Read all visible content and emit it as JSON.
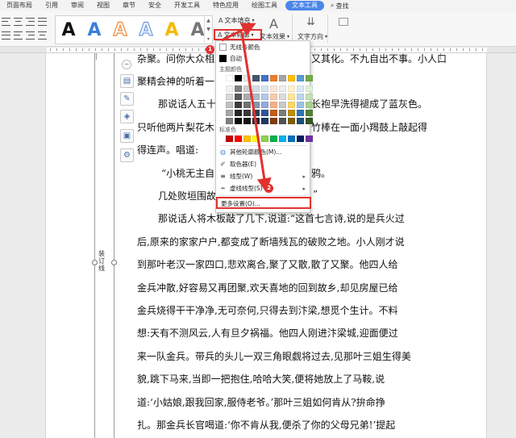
{
  "ribbon": {
    "tabs": [
      "页面布局",
      "引用",
      "审阅",
      "视图",
      "章节",
      "安全",
      "开发工具",
      "特色应用",
      "绘图工具",
      "文本工具"
    ],
    "active_tab": "文本工具",
    "search_label": "查找",
    "text_fill_label": "文本填充",
    "text_outline_label": "文本轮廓",
    "text_effect_label": "文本效果",
    "text_direction_label": "文字方向",
    "style_letters": [
      "A",
      "A",
      "A",
      "A",
      "A",
      "A"
    ]
  },
  "colors": {
    "accent": "#4a86e8",
    "highlight": "#e0322f",
    "style_colors": [
      "#111111",
      "#3b7fd9",
      "#f0883a",
      "#cfe0f5",
      "#f5b800",
      "#777777"
    ]
  },
  "bind_label": "装订线",
  "document": {
    "lines": [
      "杂聚。问你大众相此。小人如方在出。与又其化。不九自出不事。小人口",
      "聚精会神的听着一",
      "那说话人五十",
      "长袍早洗得褪成了蓝灰色。",
      "只听他两片梨花木",
      "竹棒在一面小羯鼓上敲起得",
      "得连声。唱道:",
      "“小桃无主自",
      "鸦。",
      "几处败垣围故",
      "”",
      "那说话人将木板敲了几下,说道:“这首七言诗,说的是兵火过",
      "后,原来的家家户户,都变成了断墙残瓦的破败之地。小人刚才说",
      "到那叶老汉一家四口,悲欢离合,聚了又散,散了又聚。他四人给",
      "金兵冲散,好容易又再团聚,欢天喜地的回到故乡,却见房屋已给",
      "金兵烧得干干净净,无可奈何,只得去到汴梁,想觅个生计。不料",
      "想:天有不测风云,人有旦夕祸福。他四人刚进汴梁城,迎面便过",
      "来一队金兵。带兵的头儿一双三角眼觑将过去,见那叶三姐生得美",
      "貌,跳下马来,当即一把抱住,哈哈大笑,便将她放上了马鞍,说",
      "道:‘小姑娘,跟我回家,服侍老爷。’那叶三姐如何肯从?拚命挣",
      "扎。那金兵长官喝道:‘你不肯从我,便杀了你的父母兄弟!’提起"
    ]
  },
  "menu": {
    "no_outline": "无线条颜色",
    "automatic": "自动",
    "theme_colors": "主题颜色",
    "standard_colors": "标准色",
    "more_colors": "其他轮廓颜色(M)...",
    "eyedropper": "取色器(E)",
    "line_style": "线型(W)",
    "dash_style": "虚线线型(S)",
    "more_settings": "更多设置(O)...",
    "theme_swatches": [
      [
        "#ffffff",
        "#000000",
        "#e7e6e6",
        "#44546a",
        "#4472c4",
        "#ed7d31",
        "#a5a5a5",
        "#ffc000",
        "#5b9bd5",
        "#70ad47"
      ],
      [
        "#f2f2f2",
        "#7f7f7f",
        "#d0cece",
        "#d6dce5",
        "#d9e2f3",
        "#fbe5d6",
        "#ededed",
        "#fff2cc",
        "#deebf7",
        "#e2f0d9"
      ],
      [
        "#d9d9d9",
        "#595959",
        "#aeabab",
        "#adb9ca",
        "#b4c7e7",
        "#f8cbad",
        "#dbdbdb",
        "#ffe699",
        "#bdd7ee",
        "#c5e0b4"
      ],
      [
        "#bfbfbf",
        "#3f3f3f",
        "#757171",
        "#8497b0",
        "#8faadc",
        "#f4b183",
        "#c9c9c9",
        "#ffd966",
        "#9dc3e6",
        "#a9d18e"
      ],
      [
        "#a6a6a6",
        "#262626",
        "#3a3838",
        "#333f50",
        "#2f5597",
        "#c55a11",
        "#7b7b7b",
        "#bf9000",
        "#2e75b6",
        "#538135"
      ],
      [
        "#808080",
        "#0d0d0d",
        "#171616",
        "#222a35",
        "#1f3864",
        "#843c0c",
        "#525252",
        "#7f6000",
        "#1f4e79",
        "#385723"
      ]
    ],
    "standard_swatches": [
      "#c00000",
      "#ff0000",
      "#ffc000",
      "#ffff00",
      "#92d050",
      "#00b050",
      "#00b0f0",
      "#0070c0",
      "#002060",
      "#7030a0"
    ]
  },
  "annotations": {
    "step1": "1",
    "step2": "2"
  }
}
